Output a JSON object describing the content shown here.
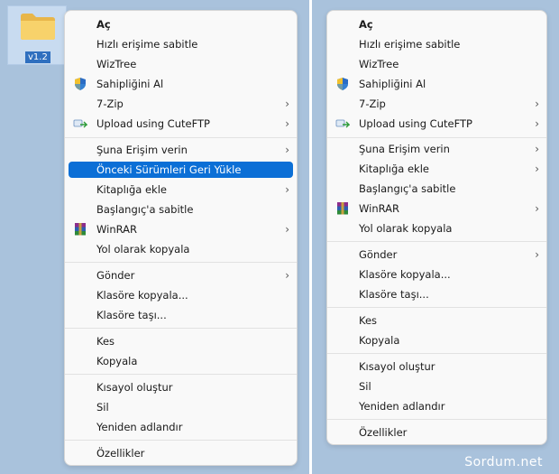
{
  "desktop": {
    "folder_label": "v1.2",
    "accent_color": "#0b6fd6"
  },
  "menu_left": {
    "items": [
      {
        "label": "Aç",
        "bold": true
      },
      {
        "label": "Hızlı erişime sabitle"
      },
      {
        "label": "WizTree"
      },
      {
        "label": "Sahipliğini Al",
        "icon": "shield-icon"
      },
      {
        "label": "7-Zip",
        "submenu": true
      },
      {
        "label": "Upload using CuteFTP",
        "icon": "cuteftp-icon",
        "submenu": true
      },
      {
        "label": "Şuna Erişim verin",
        "submenu": true
      },
      {
        "label": "Önceki Sürümleri Geri Yükle",
        "highlighted": true
      },
      {
        "label": "Kitaplığa ekle",
        "submenu": true
      },
      {
        "label": "Başlangıç'a sabitle"
      },
      {
        "label": "WinRAR",
        "icon": "winrar-icon",
        "submenu": true
      },
      {
        "label": "Yol olarak kopyala"
      },
      {
        "label": "Gönder",
        "submenu": true
      },
      {
        "label": "Klasöre kopyala..."
      },
      {
        "label": "Klasöre taşı..."
      },
      {
        "label": "Kes"
      },
      {
        "label": "Kopyala"
      },
      {
        "label": "Kısayol oluştur"
      },
      {
        "label": "Sil"
      },
      {
        "label": "Yeniden adlandır"
      },
      {
        "label": "Özellikler"
      }
    ]
  },
  "menu_right": {
    "items": [
      {
        "label": "Aç",
        "bold": true
      },
      {
        "label": "Hızlı erişime sabitle"
      },
      {
        "label": "WizTree"
      },
      {
        "label": "Sahipliğini Al",
        "icon": "shield-icon"
      },
      {
        "label": "7-Zip",
        "submenu": true
      },
      {
        "label": "Upload using CuteFTP",
        "icon": "cuteftp-icon",
        "submenu": true
      },
      {
        "label": "Şuna Erişim verin",
        "submenu": true
      },
      {
        "label": "Kitaplığa ekle",
        "submenu": true
      },
      {
        "label": "Başlangıç'a sabitle"
      },
      {
        "label": "WinRAR",
        "icon": "winrar-icon",
        "submenu": true
      },
      {
        "label": "Yol olarak kopyala"
      },
      {
        "label": "Gönder",
        "submenu": true
      },
      {
        "label": "Klasöre kopyala..."
      },
      {
        "label": "Klasöre taşı..."
      },
      {
        "label": "Kes"
      },
      {
        "label": "Kopyala"
      },
      {
        "label": "Kısayol oluştur"
      },
      {
        "label": "Sil"
      },
      {
        "label": "Yeniden adlandır"
      },
      {
        "label": "Özellikler"
      }
    ]
  },
  "watermark": "Sordum.net"
}
